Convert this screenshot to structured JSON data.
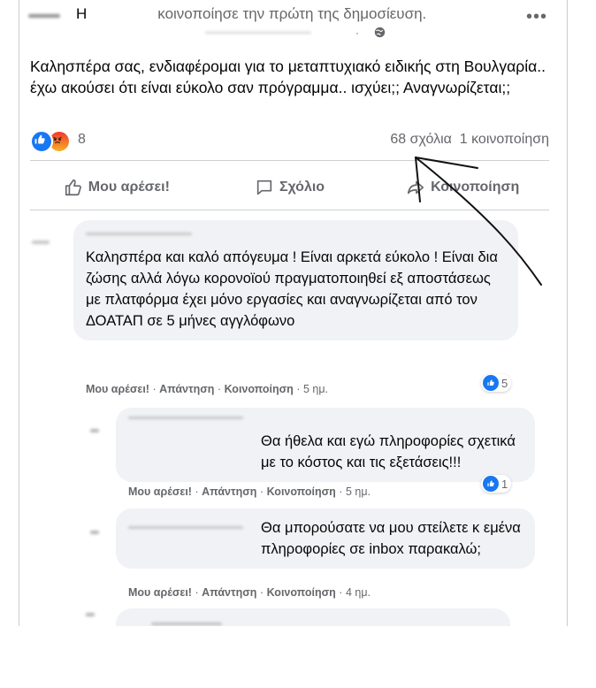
{
  "post": {
    "author_initial": "Η",
    "shared_text": "κοινοποίησε την πρώτη της δημοσίευση.",
    "meta": "·",
    "body": "Καλησπέρα σας, ενδιαφέρομαι για το μεταπτυχιακό ειδικής στη Βουλγαρία.. έχω ακούσει ότι είναι εύκολο σαν πρόγραμμα.. ισχύει;; Αναγνωρίζεται;;",
    "reaction_count": "8",
    "comments_count": "68 σχόλια",
    "shares_count": "1 κοινοποίηση",
    "more_icon": "more-horizontal-icon",
    "privacy_icon": "globe-icon"
  },
  "actions": {
    "like": "Μου αρέσει!",
    "comment": "Σχόλιο",
    "share": "Κοινοποίηση"
  },
  "comments": [
    {
      "text": "Καλησπέρα και καλό απόγευμα ! Είναι αρκετά εύκολο ! Είναι δια ζώσης αλλά λόγω κορονοϊού πραγματοποιηθεί εξ αποστάσεως με πλατφόρμα έχει μόνο εργασίες και αναγνωρίζεται από τον ΔΟΑΤΑΠ σε 5 μήνες αγγλόφωνο",
      "like": "Μου αρέσει!",
      "reply": "Απάντηση",
      "share": "Κοινοποίηση",
      "time": "5 ημ.",
      "likes": "5"
    },
    {
      "text": "Θα ήθελα και εγώ πληροφορίες σχετικά με το κόστος και τις εξετάσεις!!!",
      "like": "Μου αρέσει!",
      "reply": "Απάντηση",
      "share": "Κοινοποίηση",
      "time": "5 ημ.",
      "likes": "1"
    },
    {
      "text": "Θα μπορούσατε να μου στείλετε κ εμένα πληροφορίες σε inbox παρακαλώ;",
      "like": "Μου αρέσει!",
      "reply": "Απάντηση",
      "share": "Κοινοποίηση",
      "time": "4 ημ."
    }
  ],
  "separator": "·",
  "colors": {
    "accent": "#1877f2",
    "muted": "#65676b",
    "bubble": "#f0f2f5"
  }
}
